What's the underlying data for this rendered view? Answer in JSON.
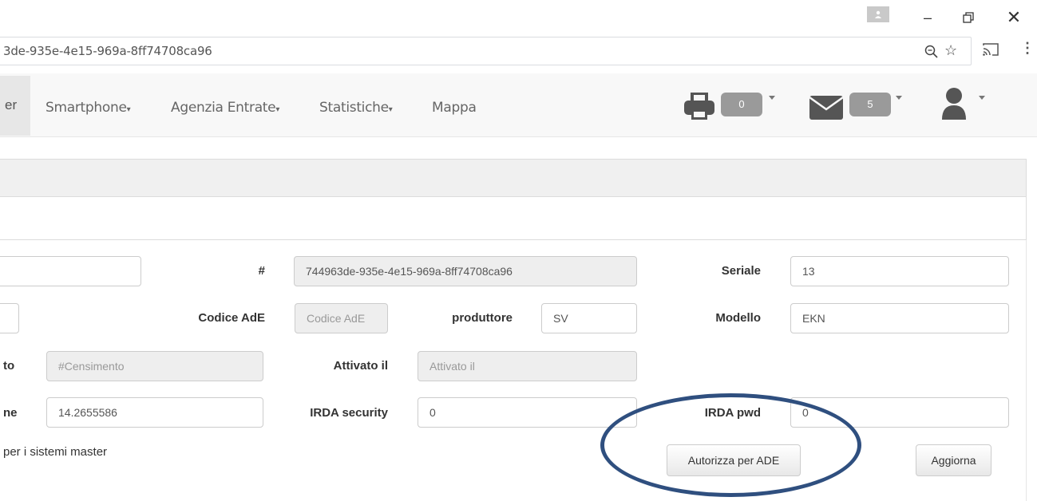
{
  "browser": {
    "url_fragment": "3de-935e-4e15-969a-8ff74708ca96",
    "icons": [
      "profile-icon",
      "minimize-icon",
      "restore-icon",
      "close-icon",
      "zoom-icon",
      "star-icon",
      "cast-icon",
      "more-icon"
    ]
  },
  "navbar": {
    "active_fragment": "er",
    "items": [
      {
        "label": "Smartphone",
        "caret": "▾"
      },
      {
        "label": "Agenzia Entrate",
        "caret": "▾"
      },
      {
        "label": "Statistiche",
        "caret": "▾"
      },
      {
        "label": "Mappa",
        "caret": ""
      }
    ],
    "print_count": "0",
    "mail_count": "5"
  },
  "form": {
    "hash_label": "#",
    "hash_value": "744963de-935e-4e15-969a-8ff74708ca96",
    "seriale_label": "Seriale",
    "seriale_value": "13",
    "codice_ade_label": "Codice AdE",
    "codice_ade_placeholder": "Codice AdE",
    "produttore_label": "produttore",
    "produttore_value": "SV",
    "modello_label": "Modello",
    "modello_value": "EKN",
    "censimento_label_fragment": "to",
    "censimento_placeholder": "#Censimento",
    "attivato_label": "Attivato il",
    "attivato_placeholder": "Attivato il",
    "row4_label_fragment": "ne",
    "row4_value": "14.2655586",
    "irda_security_label": "IRDA security",
    "irda_security_value": "0",
    "irda_pwd_label": "IRDA pwd",
    "irda_pwd_value": "0",
    "master_text_fragment": "per i sistemi master"
  },
  "buttons": {
    "authorize": "Autorizza per ADE",
    "update": "Aggiorna"
  },
  "colors": {
    "navbar_bg": "#f8f8f8",
    "badge_bg": "#9a9a9a",
    "annotation_ellipse": "#2f4f7f"
  }
}
